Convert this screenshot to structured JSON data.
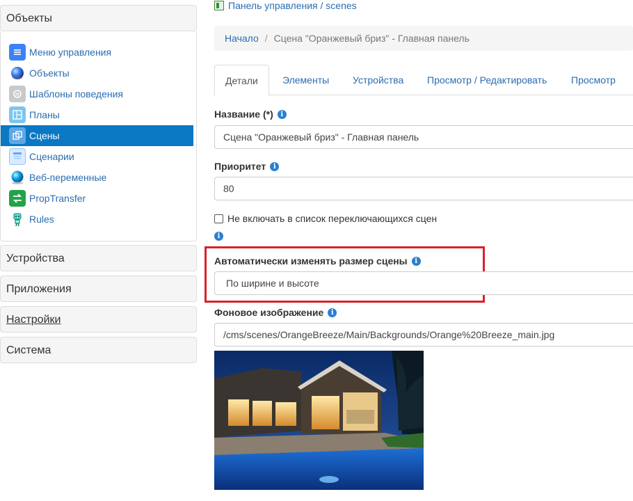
{
  "sidebar": {
    "objects_header": "Объекты",
    "items": [
      {
        "label": "Меню управления",
        "icon": "menu-icon",
        "color": "#3b82f6",
        "active": false
      },
      {
        "label": "Объекты",
        "icon": "globe-icon",
        "color": "#2563eb",
        "active": false
      },
      {
        "label": "Шаблоны поведения",
        "icon": "template-icon",
        "color": "#9ca3af",
        "active": false
      },
      {
        "label": "Планы",
        "icon": "plans-icon",
        "color": "#38bdf8",
        "active": false
      },
      {
        "label": "Сцены",
        "icon": "scenes-icon",
        "color": "#60a5fa",
        "active": true
      },
      {
        "label": "Сценарии",
        "icon": "scripts-icon",
        "color": "#93c5fd",
        "active": false
      },
      {
        "label": "Веб-переменные",
        "icon": "web-globe-icon",
        "color": "#0ea5e9",
        "active": false
      },
      {
        "label": "PropTransfer",
        "icon": "prop-transfer-icon",
        "color": "#22c55e",
        "active": false
      },
      {
        "label": "Rules",
        "icon": "robot-icon",
        "color": "#14b8a6",
        "active": false
      }
    ],
    "sections": [
      "Устройства",
      "Приложения",
      "Настройки",
      "Система"
    ]
  },
  "top_link": "Панель управления / scenes",
  "breadcrumb": {
    "home": "Начало",
    "separator": "/",
    "current": "Сцена \"Оранжевый бриз\" - Главная панель"
  },
  "tabs": [
    "Детали",
    "Элементы",
    "Устройства",
    "Просмотр / Редактировать",
    "Просмотр"
  ],
  "active_tab": "Детали",
  "form": {
    "name_label": "Название (*)",
    "name_value": "Сцена \"Оранжевый бриз\" - Главная панель",
    "priority_label": "Приоритет",
    "priority_value": "80",
    "exclude_label": "Не включать в список переключающихся сцен",
    "autosize_label": "Автоматически изменять размер сцены",
    "autosize_value": "По ширине и высоте",
    "background_label": "Фоновое изображение",
    "background_value": "/cms/scenes/OrangeBreeze/Main/Backgrounds/Orange%20Breeze_main.jpg"
  },
  "colors": {
    "accent": "#0b78c3",
    "link": "#2a6db0",
    "highlight": "#d9202a"
  }
}
